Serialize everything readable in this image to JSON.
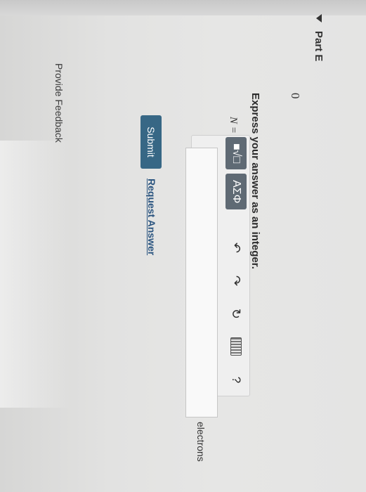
{
  "part": {
    "title": "Part E"
  },
  "question": {
    "given_value": "0",
    "prompt": "Express your answer as an integer."
  },
  "toolbar": {
    "template_button": "■√□",
    "symbols_button": "ΑΣΦ",
    "undo_glyph": "↶",
    "redo_glyph": "↷",
    "reset_glyph": "↻",
    "help_glyph": "?"
  },
  "answer": {
    "label": "N =",
    "value": "",
    "units": "electrons"
  },
  "actions": {
    "submit_label": "Submit",
    "request_label": "Request Answer"
  },
  "footer": {
    "feedback_label": "Provide Feedback"
  },
  "colors": {
    "submit_bg": "#376785",
    "toolbar_dark": "#5f6a74",
    "link": "#2b5580"
  }
}
